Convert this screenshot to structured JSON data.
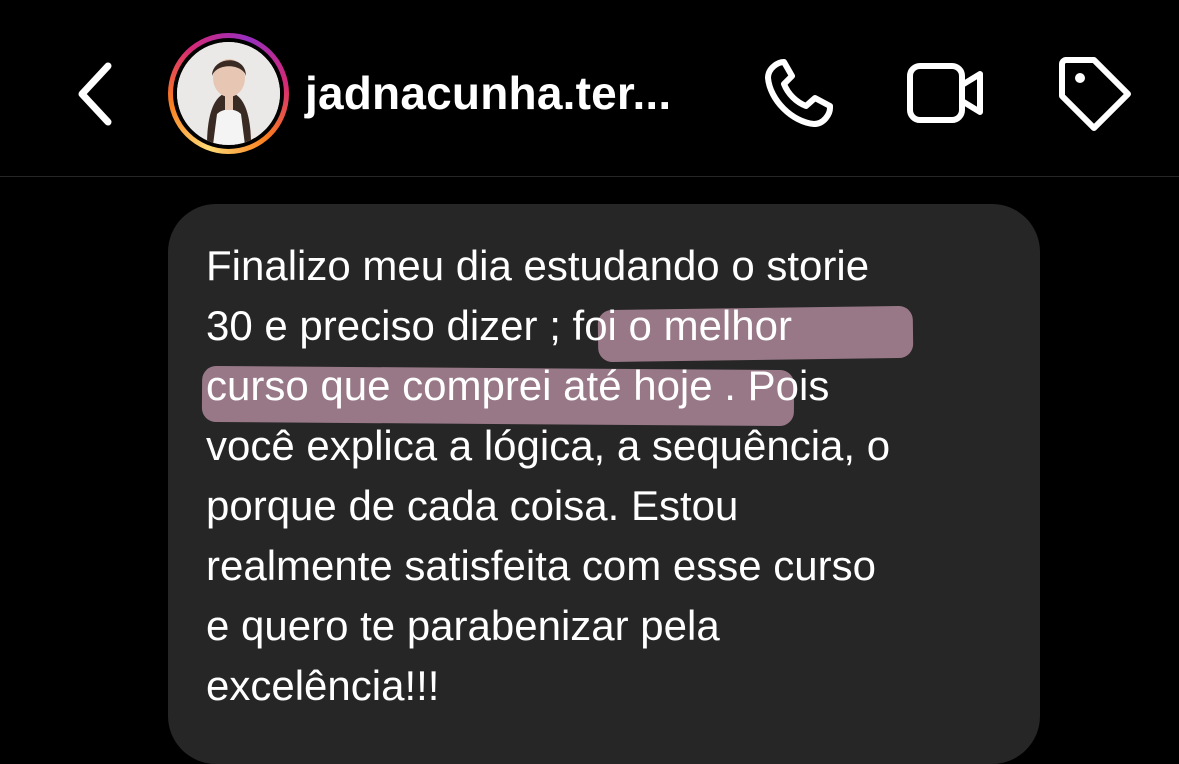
{
  "header": {
    "username": "jadnacunha.ter...",
    "icons": {
      "back": "chevron-left-icon",
      "call": "phone-icon",
      "video": "video-camera-icon",
      "tag": "tag-icon"
    },
    "avatar_ring_colors": [
      "#feda75",
      "#fa7e1e",
      "#d62976",
      "#962fbf"
    ]
  },
  "message": {
    "lines": {
      "l1": "Finalizo meu dia estudando o storie",
      "l2a": "30 e preciso dizer ",
      "l2b": "; foi o melhor",
      "l3a": "curso que comprei até hoje",
      "l3b": " . Pois",
      "l4": "você explica a lógica, a sequência, o",
      "l5": "porque de cada coisa.  Estou",
      "l6": "realmente satisfeita com esse curso",
      "l7": "e quero te parabenizar pela",
      "l8": "excelência!!!"
    },
    "highlight_color": "#b88fa3",
    "bubble_color": "#262626"
  }
}
